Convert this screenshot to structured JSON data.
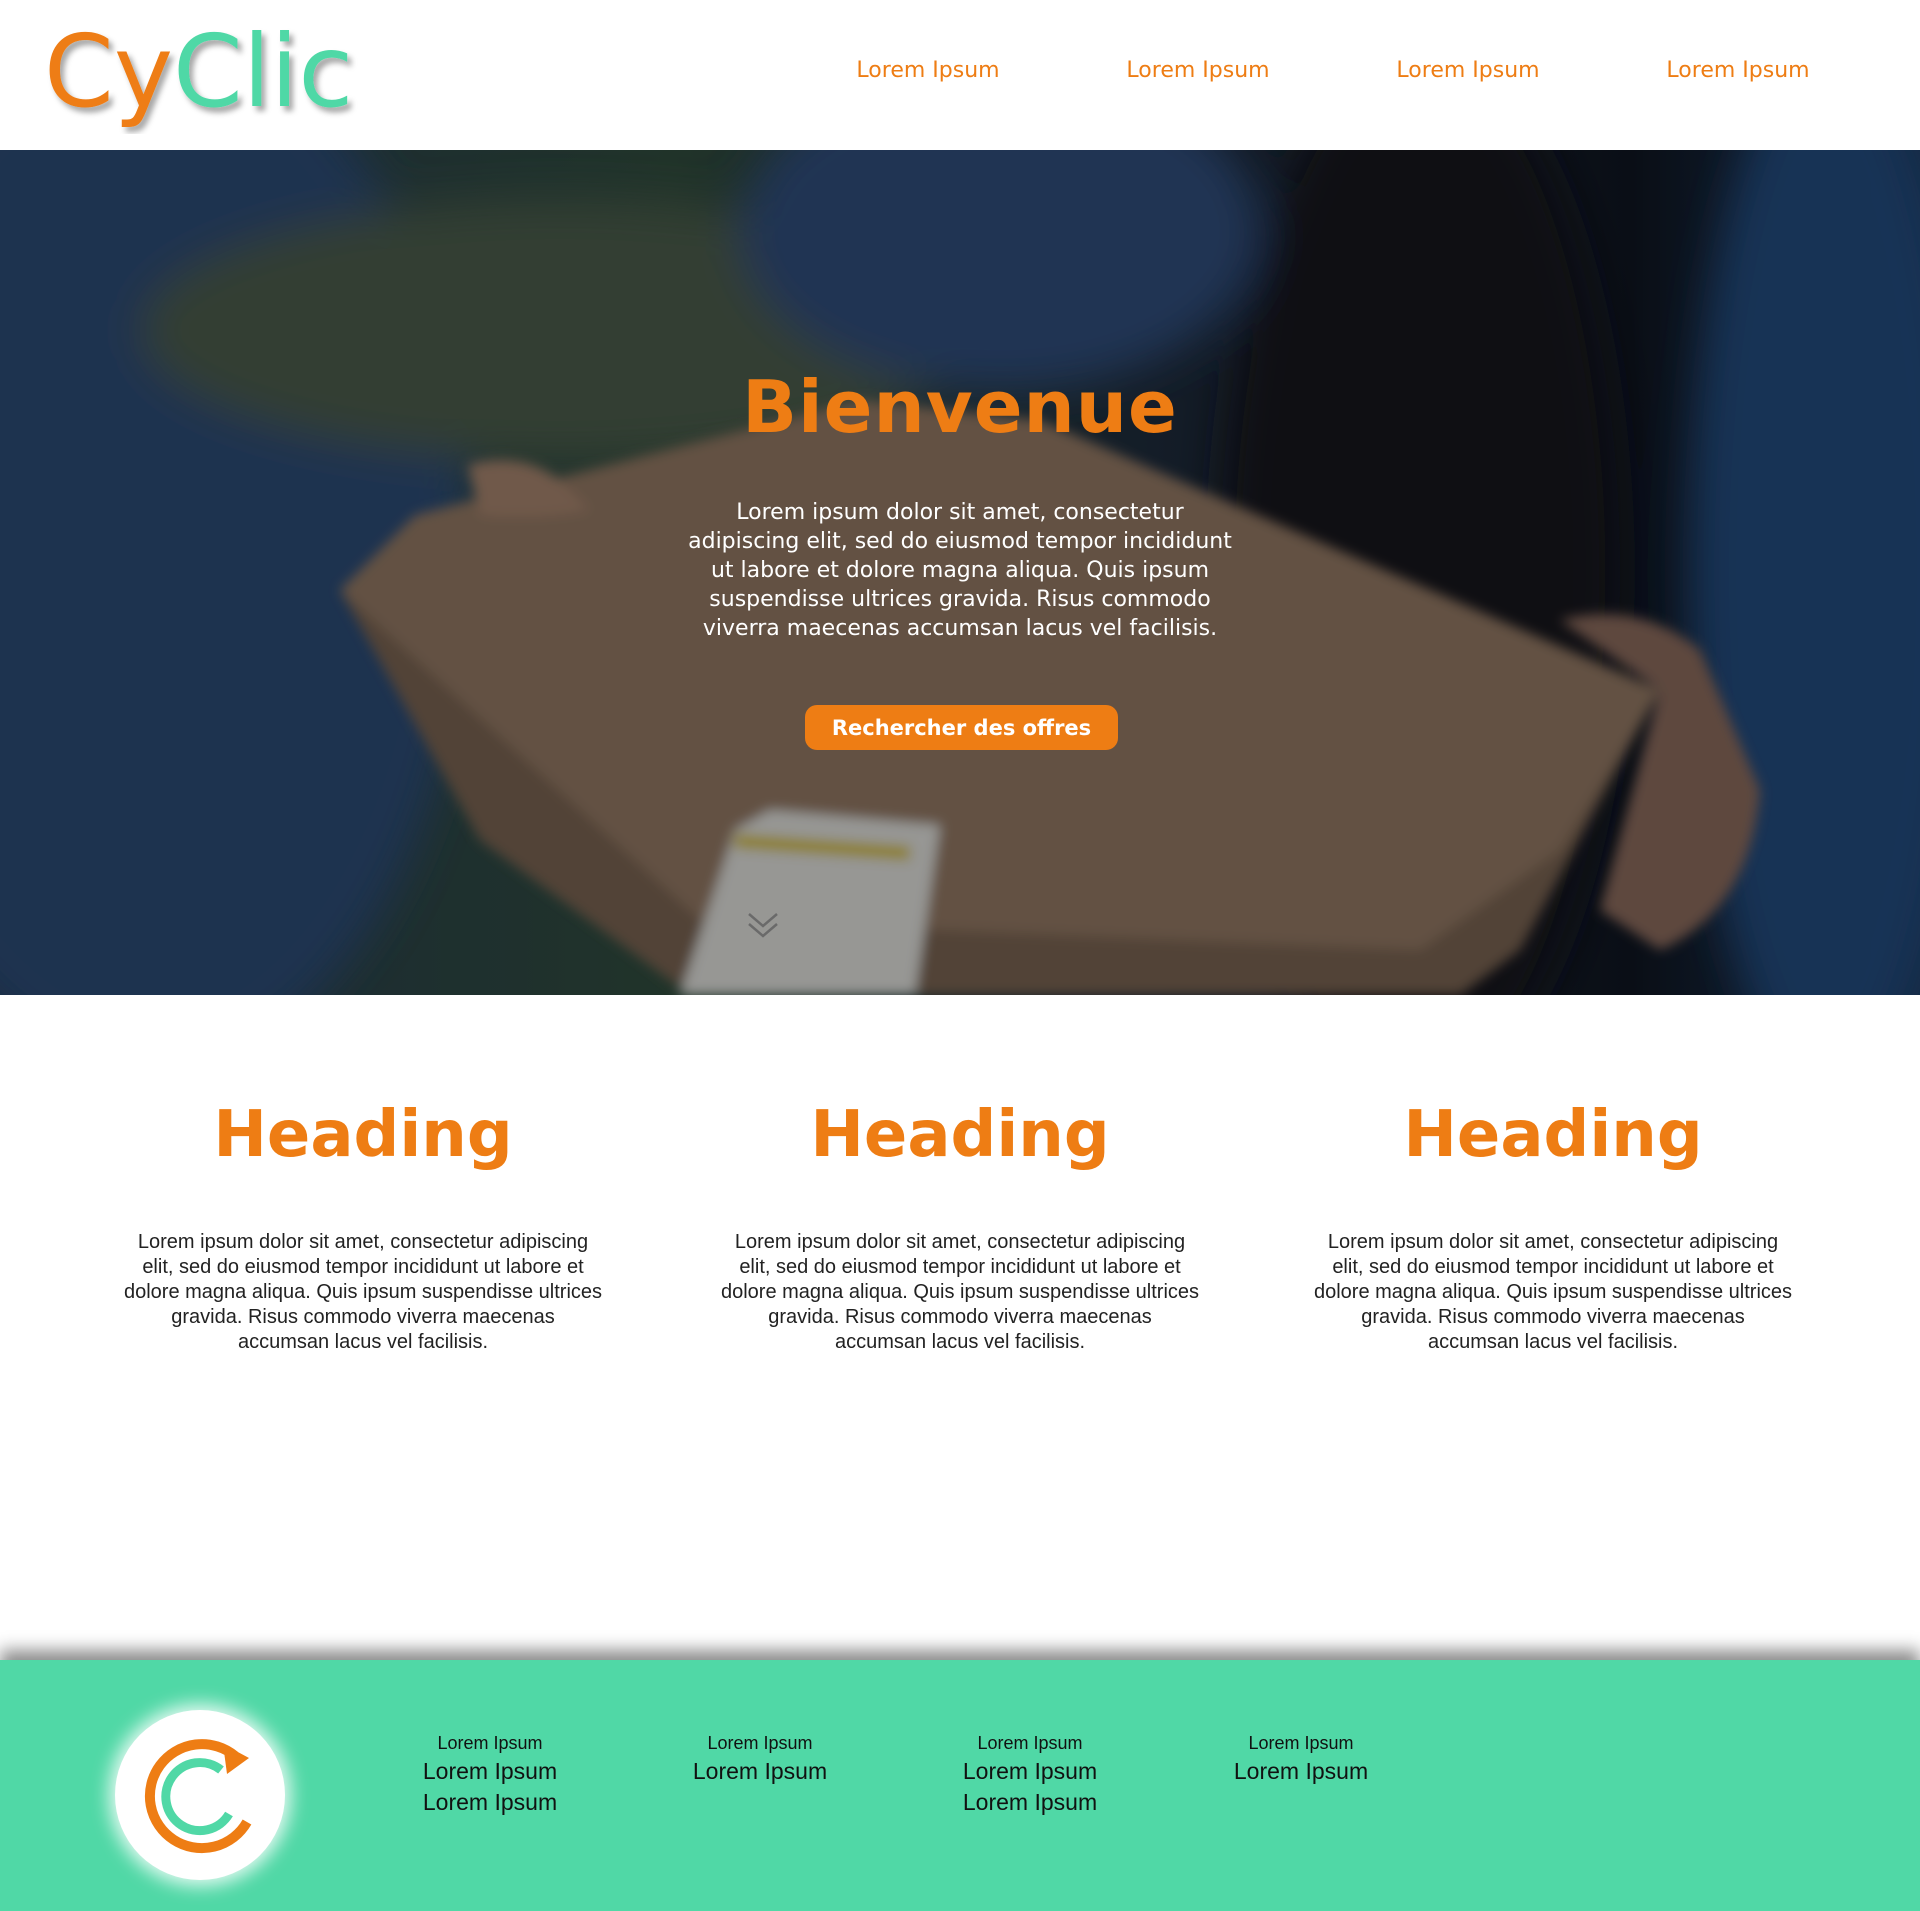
{
  "brand": {
    "logo_text_part1": "Cy",
    "logo_text_part2": "Clic",
    "primary_color": "#ee7d14",
    "secondary_color": "#50d8a6"
  },
  "nav": {
    "items": [
      {
        "label": "Lorem Ipsum"
      },
      {
        "label": "Lorem Ipsum"
      },
      {
        "label": "Lorem Ipsum"
      },
      {
        "label": "Lorem Ipsum"
      }
    ]
  },
  "hero": {
    "title": "Bienvenue",
    "text": "Lorem ipsum dolor sit amet, consectetur adipiscing elit, sed do eiusmod tempor incididunt ut labore et dolore magna aliqua. Quis ipsum suspendisse ultrices gravida. Risus commodo viverra maecenas accumsan lacus vel facilisis.",
    "button_label": "Rechercher des offres",
    "scroll_icon": "chevron-double-down-icon"
  },
  "features": [
    {
      "heading": "Heading",
      "text": "Lorem ipsum dolor sit amet, consectetur adipiscing elit, sed do eiusmod tempor incididunt ut labore et dolore magna aliqua. Quis ipsum suspendisse ultrices gravida. Risus commodo viverra maecenas accumsan lacus vel facilisis."
    },
    {
      "heading": "Heading",
      "text": "Lorem ipsum dolor sit amet, consectetur adipiscing elit, sed do eiusmod tempor incididunt ut labore et dolore magna aliqua. Quis ipsum suspendisse ultrices gravida. Risus commodo viverra maecenas accumsan lacus vel facilisis."
    },
    {
      "heading": "Heading",
      "text": "Lorem ipsum dolor sit amet, consectetur adipiscing elit, sed do eiusmod tempor incididunt ut labore et dolore magna aliqua. Quis ipsum suspendisse ultrices gravida. Risus commodo viverra maecenas accumsan lacus vel facilisis."
    }
  ],
  "footer": {
    "logo_icon": "cyclic-logo-icon",
    "columns": [
      {
        "title": "Lorem Ipsum",
        "links": [
          "Lorem Ipsum",
          "Lorem Ipsum"
        ]
      },
      {
        "title": "Lorem Ipsum",
        "links": [
          "Lorem Ipsum"
        ]
      },
      {
        "title": "Lorem Ipsum",
        "links": [
          "Lorem Ipsum",
          "Lorem Ipsum"
        ]
      },
      {
        "title": "Lorem Ipsum",
        "links": [
          "Lorem Ipsum"
        ]
      }
    ]
  }
}
